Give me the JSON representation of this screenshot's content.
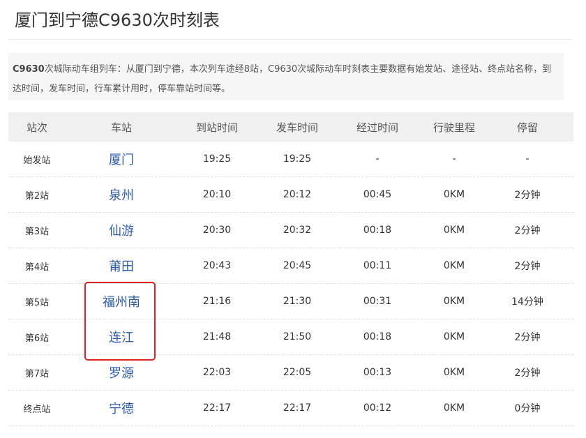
{
  "page": {
    "title": "厦门到宁德C9630次时刻表",
    "intro_strong": "C9630",
    "intro_text": "次城际动车组列车：从厦门到宁德，本次列车途经8站，C9630次城际动车时刻表主要数据有始发站、途径站、终点站名称，到达时间，发车时间，行车累计用时，停车靠站时间等。"
  },
  "table": {
    "headers": [
      "站次",
      "车站",
      "到站时间",
      "发车时间",
      "经过时间",
      "行驶里程",
      "停留"
    ],
    "rows": [
      [
        "始发站",
        "厦门",
        "19:25",
        "19:25",
        "-",
        "-",
        "-"
      ],
      [
        "第2站",
        "泉州",
        "20:10",
        "20:12",
        "00:45",
        "0KM",
        "2分钟"
      ],
      [
        "第3站",
        "仙游",
        "20:30",
        "20:32",
        "00:18",
        "0KM",
        "2分钟"
      ],
      [
        "第4站",
        "莆田",
        "20:43",
        "20:45",
        "00:11",
        "0KM",
        "2分钟"
      ],
      [
        "第5站",
        "福州南",
        "21:16",
        "21:30",
        "00:31",
        "0KM",
        "14分钟"
      ],
      [
        "第6站",
        "连江",
        "21:48",
        "21:50",
        "00:18",
        "0KM",
        "2分钟"
      ],
      [
        "第7站",
        "罗源",
        "22:03",
        "22:05",
        "00:13",
        "0KM",
        "2分钟"
      ],
      [
        "终点站",
        "宁德",
        "22:17",
        "22:17",
        "00:12",
        "0KM",
        "0分钟"
      ]
    ]
  },
  "colors": {
    "station_link": "#2f5aa8",
    "highlight_border": "#e02020",
    "header_bg": "#f0f0f0",
    "intro_bg": "#f6f6f6"
  }
}
